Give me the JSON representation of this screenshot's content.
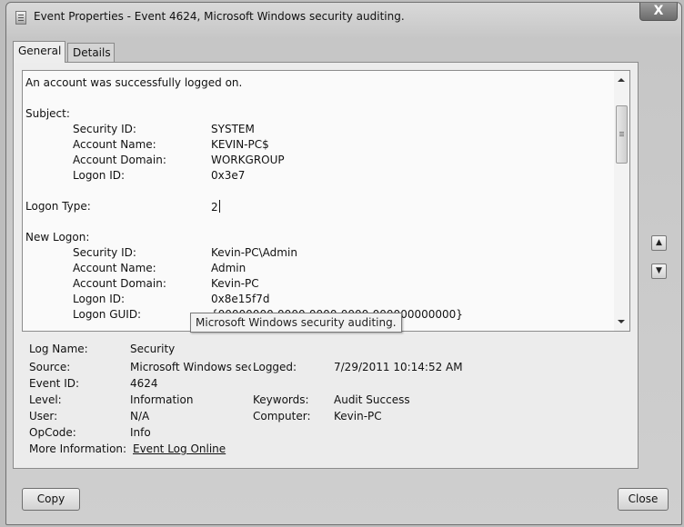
{
  "window": {
    "title": "Event Properties - Event 4624, Microsoft Windows security auditing.",
    "close_glyph": "X"
  },
  "tabs": [
    {
      "label": "General",
      "active": true
    },
    {
      "label": "Details",
      "active": false
    }
  ],
  "description": {
    "summary": "An account was successfully logged on.",
    "subject_heading": "Subject:",
    "subject": [
      {
        "label": "Security ID:",
        "value": "SYSTEM"
      },
      {
        "label": "Account Name:",
        "value": "KEVIN-PC$"
      },
      {
        "label": "Account Domain:",
        "value": "WORKGROUP"
      },
      {
        "label": "Logon ID:",
        "value": "0x3e7"
      }
    ],
    "logon_type_label": "Logon Type:",
    "logon_type_value": "2",
    "new_logon_heading": "New Logon:",
    "new_logon": [
      {
        "label": "Security ID:",
        "value": "Kevin-PC\\Admin"
      },
      {
        "label": "Account Name:",
        "value": "Admin"
      },
      {
        "label": "Account Domain:",
        "value": "Kevin-PC"
      },
      {
        "label": "Logon ID:",
        "value": "0x8e15f7d"
      },
      {
        "label": "Logon GUID:",
        "value": "{00000000-0000-0000-0000-000000000000}"
      }
    ]
  },
  "details": {
    "log_name": {
      "label": "Log Name:",
      "value": "Security"
    },
    "source": {
      "label": "Source:",
      "value": "Microsoft Windows sec"
    },
    "event_id": {
      "label": "Event ID:",
      "value": "4624"
    },
    "level": {
      "label": "Level:",
      "value": "Information"
    },
    "user": {
      "label": "User:",
      "value": "N/A"
    },
    "opcode": {
      "label": "OpCode:",
      "value": "Info"
    },
    "more_info": {
      "label": "More Information:",
      "link": "Event Log Online"
    },
    "logged": {
      "label": "Logged:",
      "value": "7/29/2011 10:14:52 AM"
    },
    "keywords": {
      "label": "Keywords:",
      "value": "Audit Success"
    },
    "computer": {
      "label": "Computer:",
      "value": "Kevin-PC"
    }
  },
  "tooltip": "Microsoft Windows security auditing.",
  "buttons": {
    "copy": "Copy",
    "close": "Close",
    "previous_icon": "arrow-up-icon",
    "next_icon": "arrow-down-icon"
  }
}
